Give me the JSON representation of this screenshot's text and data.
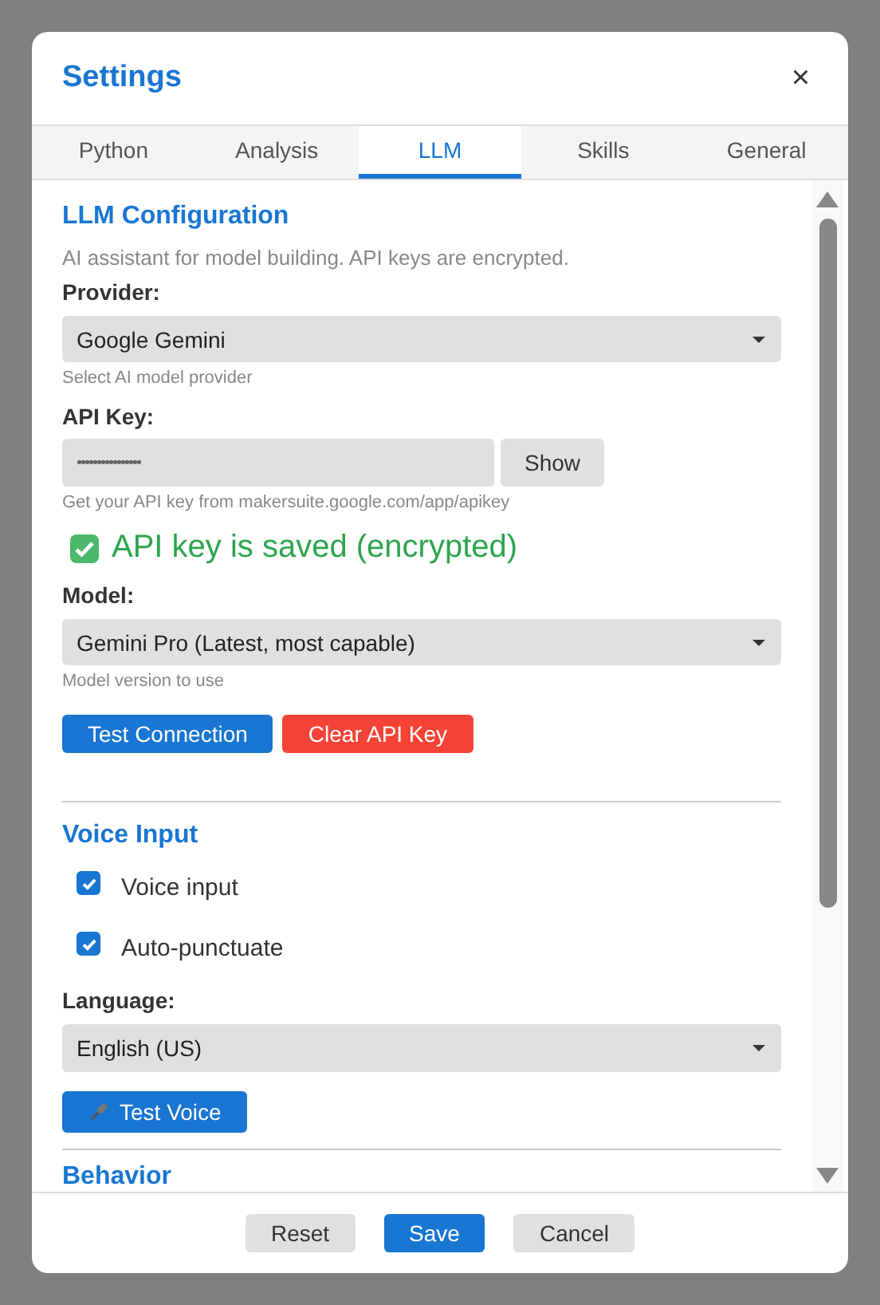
{
  "dialog": {
    "title": "Settings",
    "close": "×"
  },
  "tabs": [
    {
      "label": "Python",
      "selected": false
    },
    {
      "label": "Analysis",
      "selected": false
    },
    {
      "label": "LLM",
      "selected": true
    },
    {
      "label": "Skills",
      "selected": false
    },
    {
      "label": "General",
      "selected": false
    }
  ],
  "llm": {
    "heading": "LLM Configuration",
    "description": "AI assistant for model building. API keys are encrypted.",
    "provider": {
      "label": "Provider:",
      "value": "Google Gemini",
      "hint": "Select AI model provider"
    },
    "api_key": {
      "label": "API Key:",
      "value": "••••••••••••••••",
      "show_button": "Show",
      "hint": "Get your API key from makersuite.google.com/app/apikey"
    },
    "status": "API key is saved (encrypted)",
    "model": {
      "label": "Model:",
      "value": "Gemini Pro (Latest, most capable)",
      "hint": "Model version to use"
    },
    "buttons": [
      {
        "label": "Test Connection",
        "kind": "primary"
      },
      {
        "label": "Clear API Key",
        "kind": "danger"
      }
    ]
  },
  "voice": {
    "heading": "Voice Input",
    "options": [
      {
        "label": "Voice input",
        "checked": true
      },
      {
        "label": "Auto-punctuate",
        "checked": true
      }
    ],
    "language": {
      "label": "Language:",
      "value": "English (US)"
    },
    "test_button": "Test Voice"
  },
  "behavior": {
    "heading": "Behavior"
  },
  "footer": [
    {
      "label": "Reset",
      "kind": "secondary"
    },
    {
      "label": "Save",
      "kind": "primary"
    },
    {
      "label": "Cancel",
      "kind": "secondary"
    }
  ]
}
